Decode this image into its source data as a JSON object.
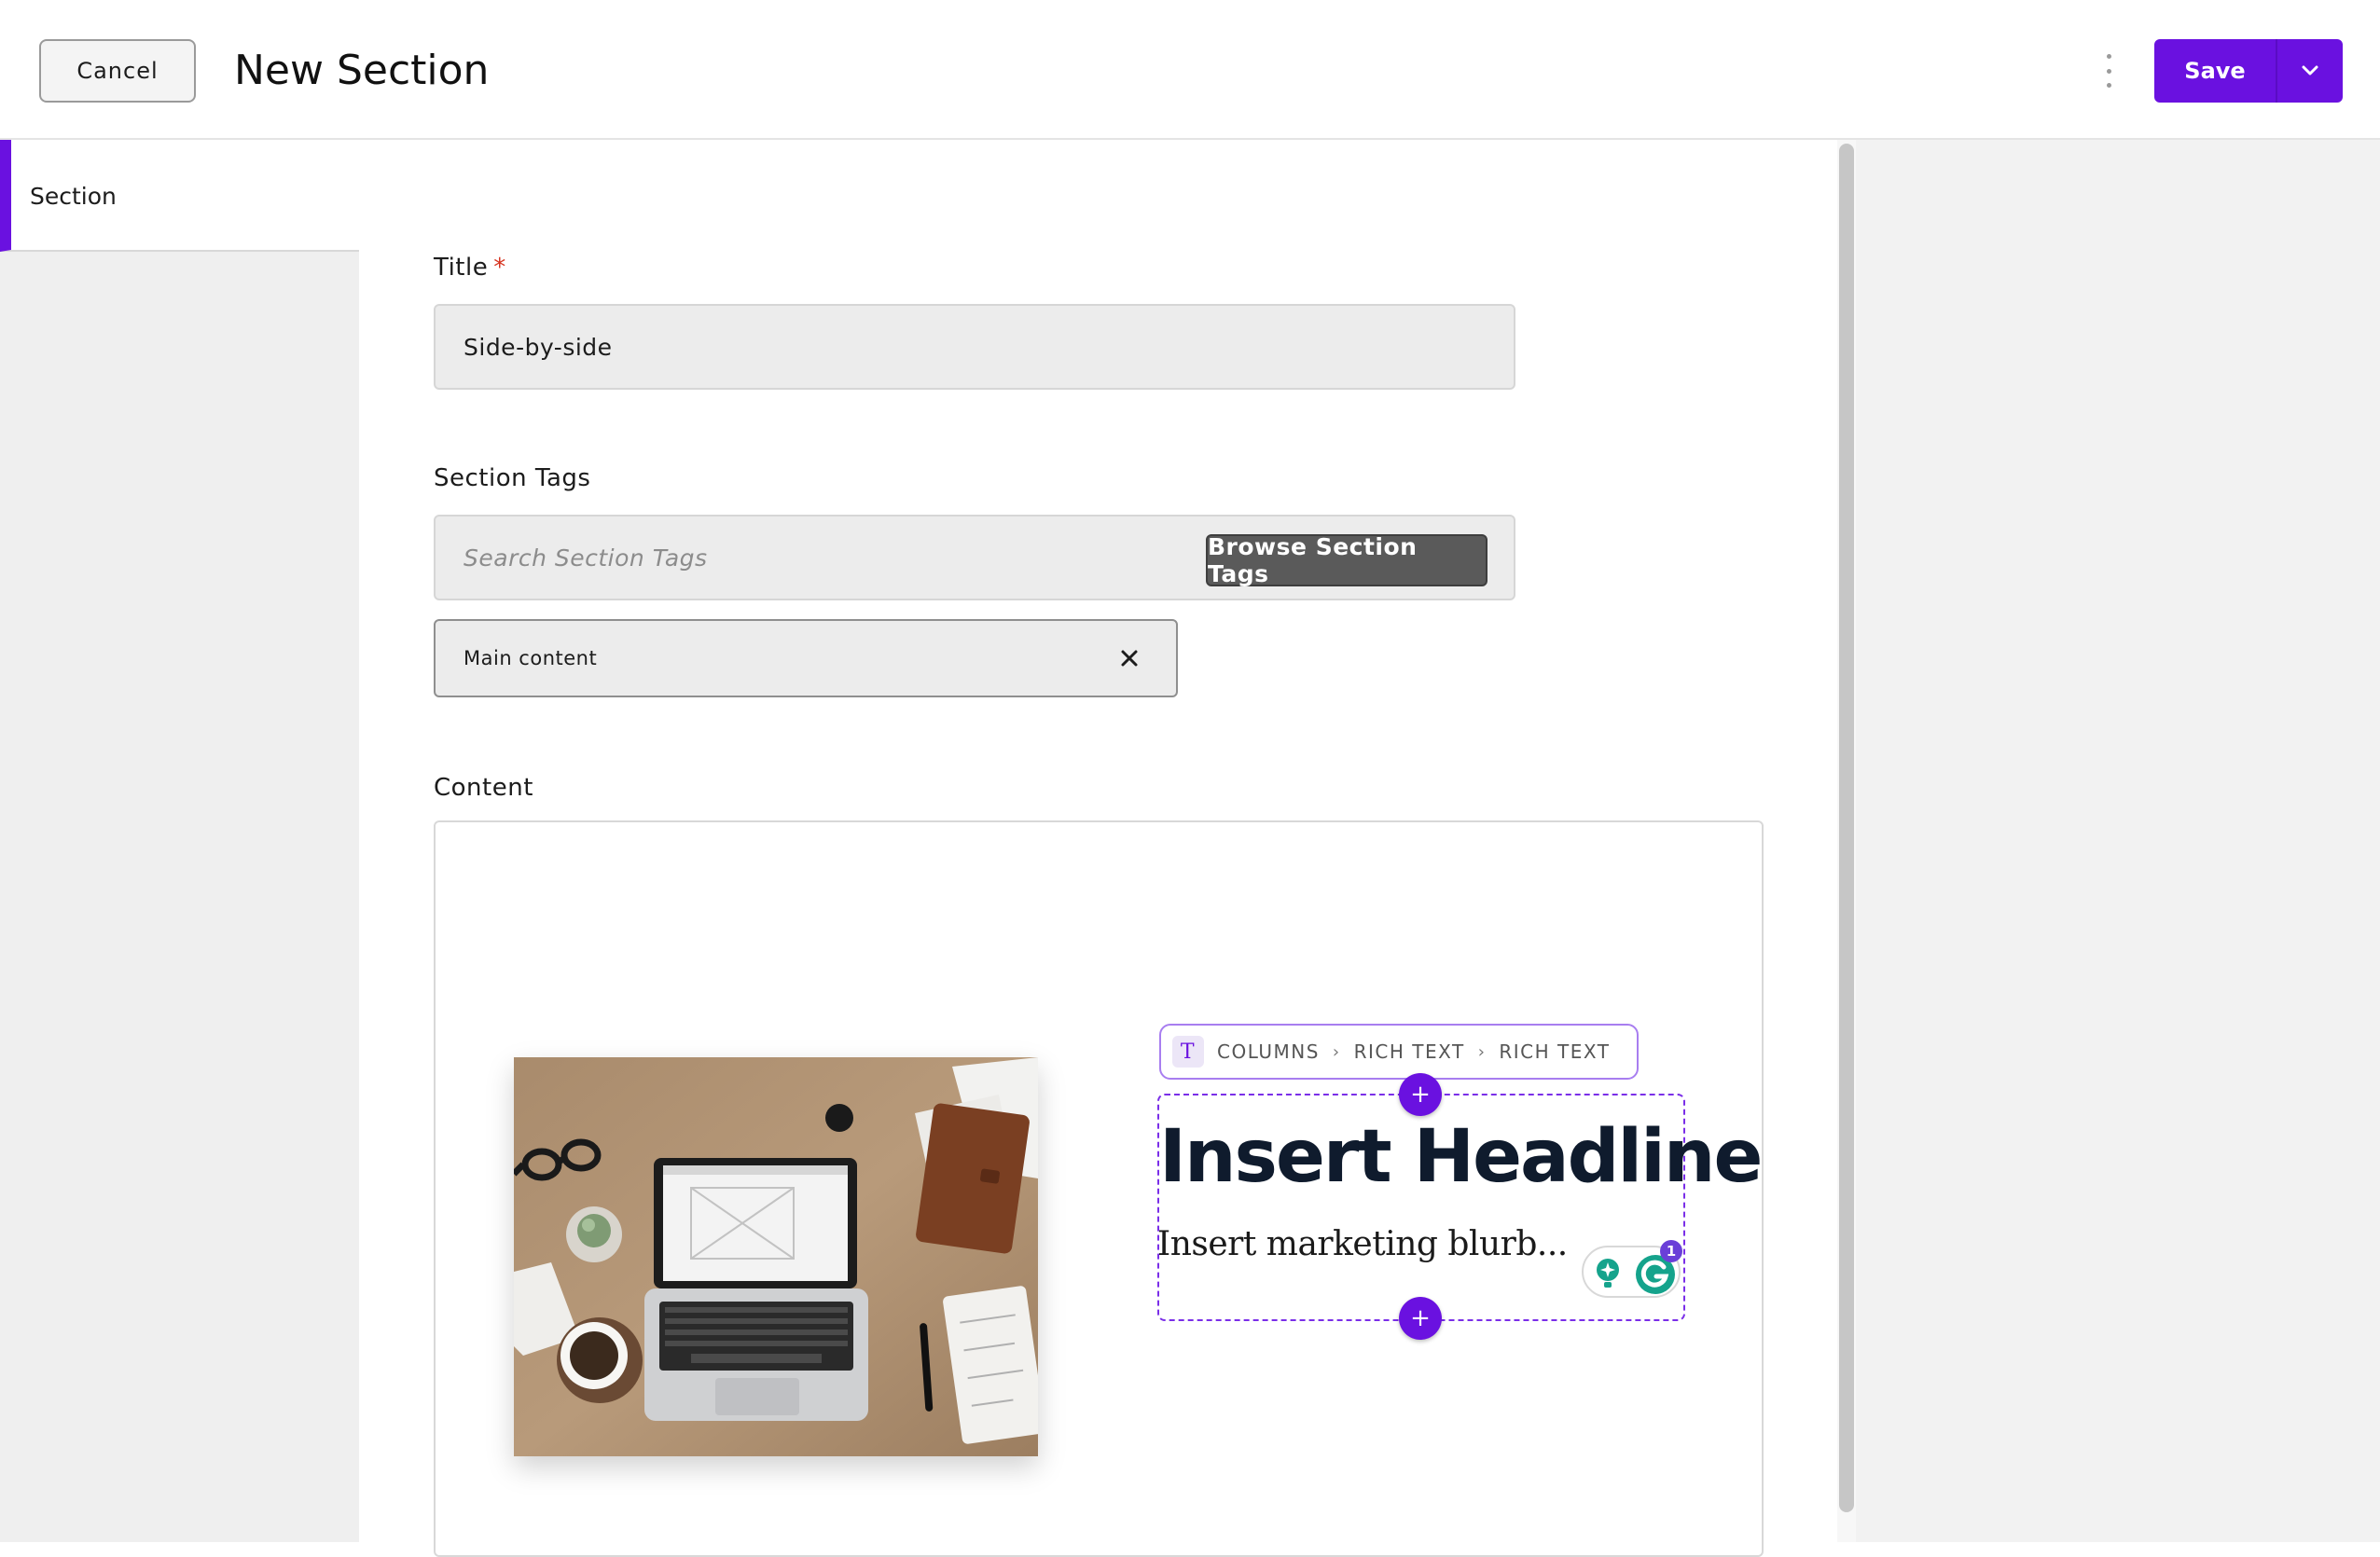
{
  "header": {
    "cancel_label": "Cancel",
    "title": "New Section",
    "save_label": "Save"
  },
  "sidebar": {
    "items": [
      {
        "label": "Section",
        "active": true
      }
    ]
  },
  "form": {
    "title_field": {
      "label": "Title",
      "required_marker": "*",
      "value": "Side-by-side"
    },
    "tags_field": {
      "label": "Section Tags",
      "placeholder": "Search Section Tags",
      "browse_label": "Browse Section Tags",
      "selected_tags": [
        "Main content"
      ]
    },
    "content_field": {
      "label": "Content"
    }
  },
  "editor": {
    "breadcrumb": [
      "COLUMNS",
      "RICH TEXT",
      "RICH TEXT"
    ],
    "breadcrumb_icon": "T",
    "headline": "Insert Headline",
    "blurb": "Insert marketing blurb...",
    "grammarly_badge_count": "1",
    "image": {
      "description_icon": "laptop-desk-photo"
    }
  },
  "colors": {
    "accent": "#6a11e0",
    "required": "#d6331f",
    "grammarly_green": "#15a38c"
  }
}
